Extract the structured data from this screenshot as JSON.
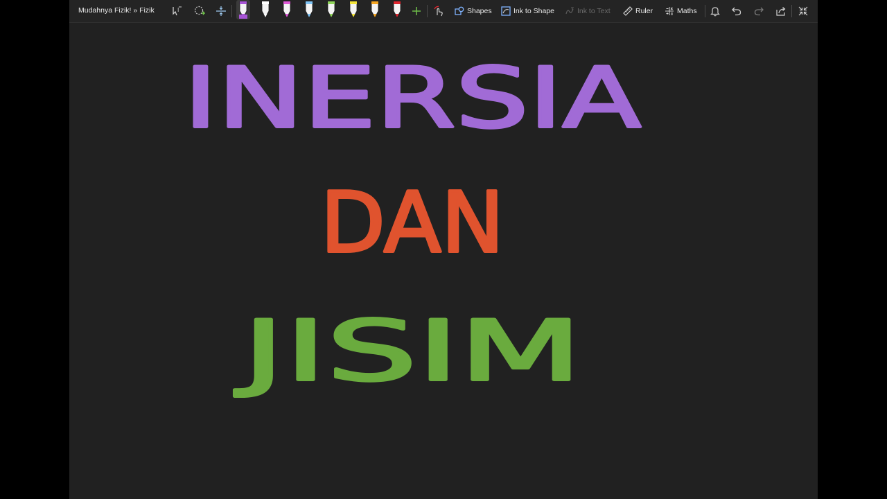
{
  "toolbar": {
    "breadcrumb": "Mudahnya Fizik! » Fizik",
    "shapes_label": "Shapes",
    "ink_to_shape_label": "Ink to Shape",
    "ink_to_text_label": "Ink to Text",
    "ruler_label": "Ruler",
    "maths_label": "Maths",
    "pens": [
      {
        "name": "pen-purple",
        "color": "#a855d6",
        "selected": true
      },
      {
        "name": "pen-white",
        "color": "#ffffff"
      },
      {
        "name": "pen-pink",
        "color": "#e05bd8"
      },
      {
        "name": "pen-lightblue",
        "color": "#7fc4f5"
      },
      {
        "name": "pen-lightgreen",
        "color": "#8fd45a"
      },
      {
        "name": "pen-yellow",
        "color": "#f2e33a"
      },
      {
        "name": "pen-orange",
        "color": "#f5a623"
      },
      {
        "name": "pen-red",
        "color": "#e0262f"
      }
    ]
  },
  "canvas": {
    "lines": [
      {
        "text": "INERSIA",
        "color": "#a16bd6"
      },
      {
        "text": "DAN",
        "color": "#e0532e"
      },
      {
        "text": "JISIM",
        "color": "#6aab3e"
      }
    ]
  }
}
